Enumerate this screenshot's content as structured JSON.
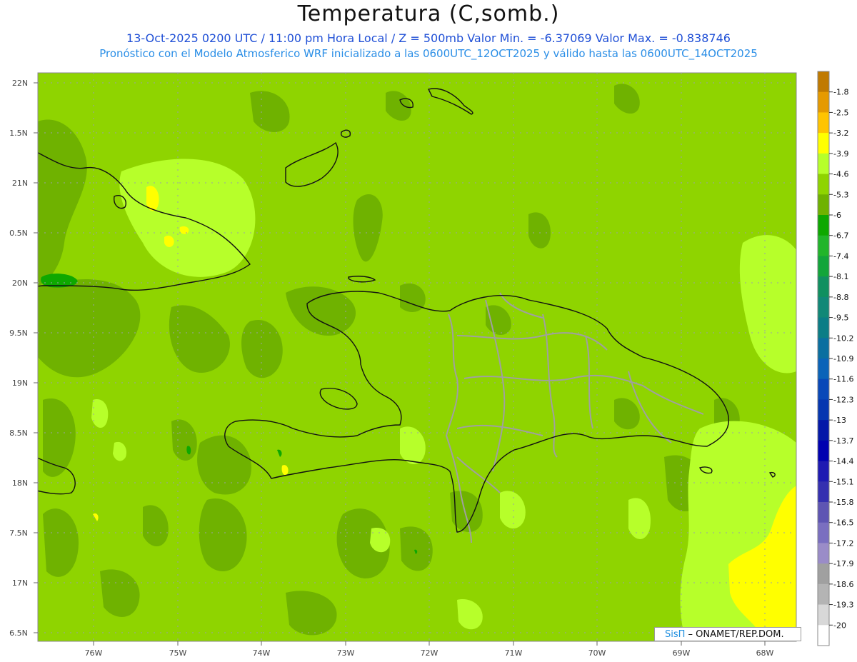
{
  "title": "Temperatura (C,somb.)",
  "subtitle_line1": "13-Oct-2025  0200 UTC / 11:00 pm Hora Local / Z = 500mb Valor Min. = -6.37069  Valor Max. = -0.838746",
  "subtitle_line2": "Pronóstico con el Modelo Atmosferico WRF inicializado a las 0600UTC_12OCT2025 y válido hasta las  0600UTC_14OCT2025",
  "credit": {
    "brand": "SisΠ",
    "rest": " – ONAMET/REP.DOM."
  },
  "lat_labels": [
    "22N",
    "1.5N",
    "21N",
    "0.5N",
    "20N",
    "9.5N",
    "19N",
    "8.5N",
    "18N",
    "7.5N",
    "17N",
    "6.5N"
  ],
  "lon_labels": [
    "76W",
    "75W",
    "74W",
    "73W",
    "72W",
    "71W",
    "70W",
    "69W",
    "68W"
  ],
  "colorbar": {
    "labels": [
      "-1.8",
      "-2.5",
      "-3.2",
      "-3.9",
      "-4.6",
      "-5.3",
      "-6",
      "-6.7",
      "-7.4",
      "-8.1",
      "-8.8",
      "-9.5",
      "-10.2",
      "-10.9",
      "-11.6",
      "-12.3",
      "-13",
      "-13.7",
      "-14.4",
      "-15.1",
      "-15.8",
      "-16.5",
      "-17.2",
      "-17.9",
      "-18.6",
      "-19.3",
      "-20"
    ],
    "colors": [
      "#c07a00",
      "#e59a00",
      "#ffc400",
      "#ffff00",
      "#b7ff2a",
      "#8fd400",
      "#6fb200",
      "#0ea800",
      "#21b52a",
      "#12a53a",
      "#109060",
      "#118877",
      "#0b7d86",
      "#0a6fa0",
      "#0a63b8",
      "#0848b8",
      "#0536b0",
      "#0418a8",
      "#0000b0",
      "#1e1ab2",
      "#3530b0",
      "#5e55b3",
      "#7a6fc0",
      "#9a8cc8",
      "#a0a0a0",
      "#b4b4b4",
      "#d8d8d8",
      "#ffffff"
    ]
  },
  "field_colors": {
    "base": "#8fd400",
    "warm": "#b7ff2a",
    "cool": "#6fb200",
    "yellow": "#ffff00",
    "coast": "#111111",
    "border": "#a0a0a0"
  }
}
